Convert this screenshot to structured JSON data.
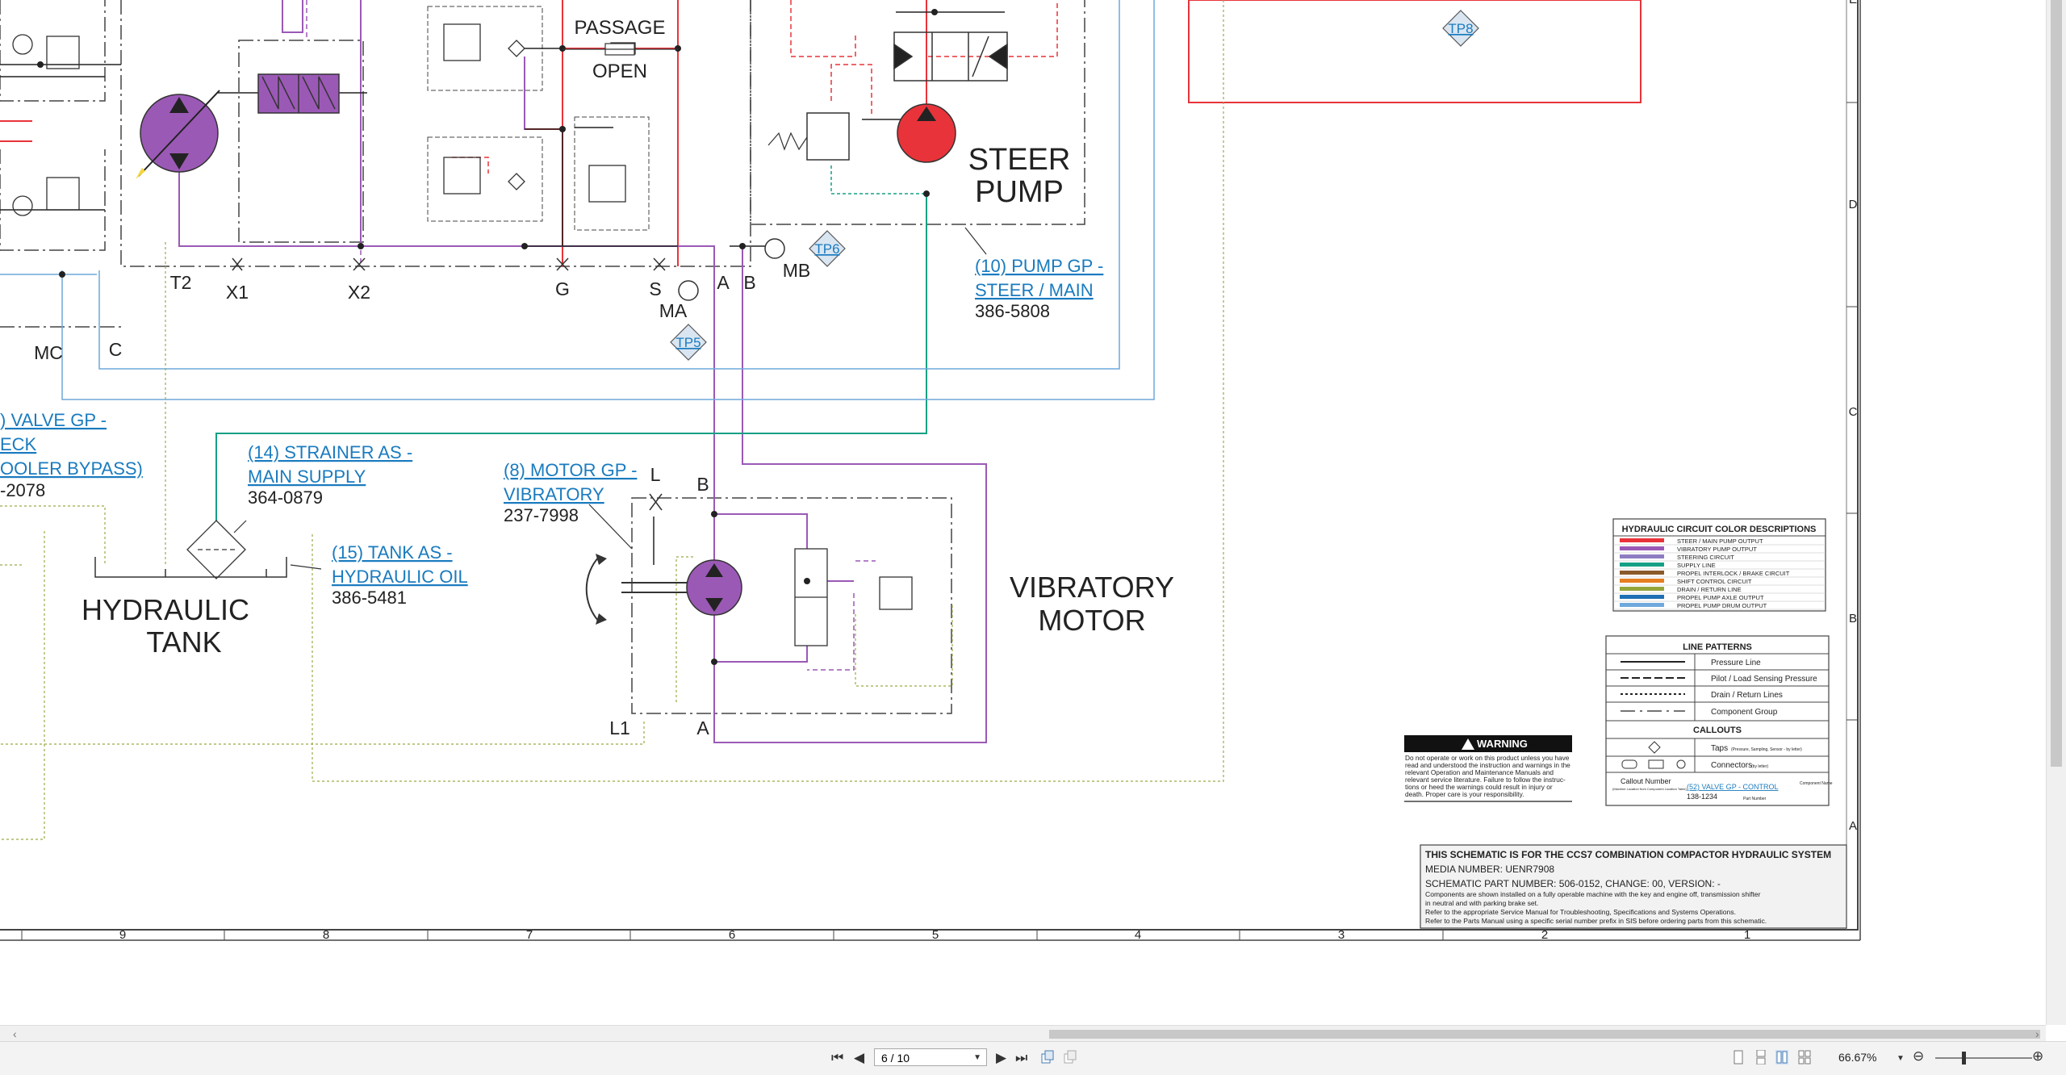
{
  "schematic": {
    "labels": {
      "passage": "PASSAGE",
      "open": "OPEN",
      "steer_pump_1": "STEER",
      "steer_pump_2": "PUMP",
      "tank_1": "HYDRAULIC",
      "tank_2": "TANK",
      "vib_motor_1": "VIBRATORY",
      "vib_motor_2": "MOTOR",
      "port_t2": "T2",
      "port_x1": "X1",
      "port_x2": "X2",
      "port_g": "G",
      "port_s": "S",
      "port_a": "A",
      "port_b": "B",
      "port_mb": "MB",
      "port_ma": "MA",
      "port_mc": "MC",
      "port_c": "C",
      "port_l": "L",
      "port_motor_b": "B",
      "port_l1": "L1",
      "port_motor_a": "A"
    },
    "tap_points": [
      "TP8",
      "TP6",
      "TP5"
    ],
    "callouts": {
      "pump_gp_line1": "(10) PUMP GP -",
      "pump_gp_line2": "STEER / MAIN",
      "pump_gp_part": "386-5808",
      "valve_gp_line1": ") VALVE GP -",
      "valve_gp_line2": "ECK",
      "valve_gp_line3": "OOLER BYPASS)",
      "valve_gp_part": "-2078",
      "strainer_line1": "(14) STRAINER AS -",
      "strainer_line2": "MAIN SUPPLY",
      "strainer_part": "364-0879",
      "motor_gp_line1": "(8) MOTOR GP -",
      "motor_gp_line2": "VIBRATORY",
      "motor_gp_part": "237-7998",
      "tank_as_line1": "(15) TANK AS -",
      "tank_as_line2": "HYDRAULIC OIL",
      "tank_as_part": "386-5481"
    },
    "grid_columns": [
      "9",
      "8",
      "7",
      "6",
      "5",
      "4",
      "3",
      "2",
      "1"
    ],
    "grid_rows": [
      "E",
      "D",
      "C",
      "B",
      "A"
    ],
    "color_legend": {
      "title": "HYDRAULIC CIRCUIT COLOR DESCRIPTIONS",
      "items": [
        {
          "color": "#e8333a",
          "label": "STEER / MAIN PUMP OUTPUT"
        },
        {
          "color": "#9b59b6",
          "label": "VIBRATORY PUMP OUTPUT"
        },
        {
          "color": "#8e7cc3",
          "label": "STEERING CIRCUIT"
        },
        {
          "color": "#16a085",
          "label": "SUPPLY LINE"
        },
        {
          "color": "#8b5a2b",
          "label": "PROPEL INTERLOCK / BRAKE CIRCUIT"
        },
        {
          "color": "#e67e22",
          "label": "SHIFT CONTROL CIRCUIT"
        },
        {
          "color": "#95a53a",
          "label": "DRAIN / RETURN LINE"
        },
        {
          "color": "#1f6fb4",
          "label": "PROPEL PUMP AXLE OUTPUT"
        },
        {
          "color": "#6fa8dc",
          "label": "PROPEL PUMP DRUM OUTPUT"
        }
      ]
    },
    "line_patterns": {
      "title": "LINE PATTERNS",
      "items": [
        "Pressure Line",
        "Pilot / Load Sensing Pressure",
        "Drain / Return Lines",
        "Component Group"
      ],
      "callouts_title": "CALLOUTS",
      "taps_label": "Taps",
      "taps_note": "(Pressure, Sampling, Sensor - by letter)",
      "connectors_label": "Connectors",
      "connectors_note": "(by letter)",
      "callout_number_label": "Callout Number",
      "callout_number_note": "(Machine Location from Component Location Table)",
      "callout_example": "(52) VALVE GP - CONTROL",
      "callout_example_part": "138-1234",
      "component_name_label": "Component Name",
      "part_number_label": "Part Number"
    },
    "warning": {
      "title": "WARNING",
      "lines": [
        "Do not operate or work on this product unless you have",
        "read and understood the instruction and warnings in the",
        "relevant Operation and Maintenance Manuals and",
        "relevant service literature. Failure to follow the instruc-",
        "tions or heed the warnings could result in injury or",
        "death. Proper care is your responsibility."
      ]
    },
    "title_block": {
      "title": "THIS SCHEMATIC IS FOR THE CCS7 COMBINATION COMPACTOR HYDRAULIC SYSTEM",
      "media": "MEDIA NUMBER: UENR7908",
      "part": "SCHEMATIC PART NUMBER: 506-0152, CHANGE: 00, VERSION: -",
      "notes": [
        "Components are shown installed on a fully operable machine with the key and engine off, transmission shifter",
        "in neutral and with parking brake set.",
        "Refer to the appropriate Service Manual for Troubleshooting, Specifications and Systems Operations.",
        "Refer to the Parts Manual using a specific serial number prefix in SIS before ordering parts from this schematic."
      ]
    }
  },
  "toolbar": {
    "page_value": "6 / 10",
    "zoom_value": "66.67%"
  }
}
